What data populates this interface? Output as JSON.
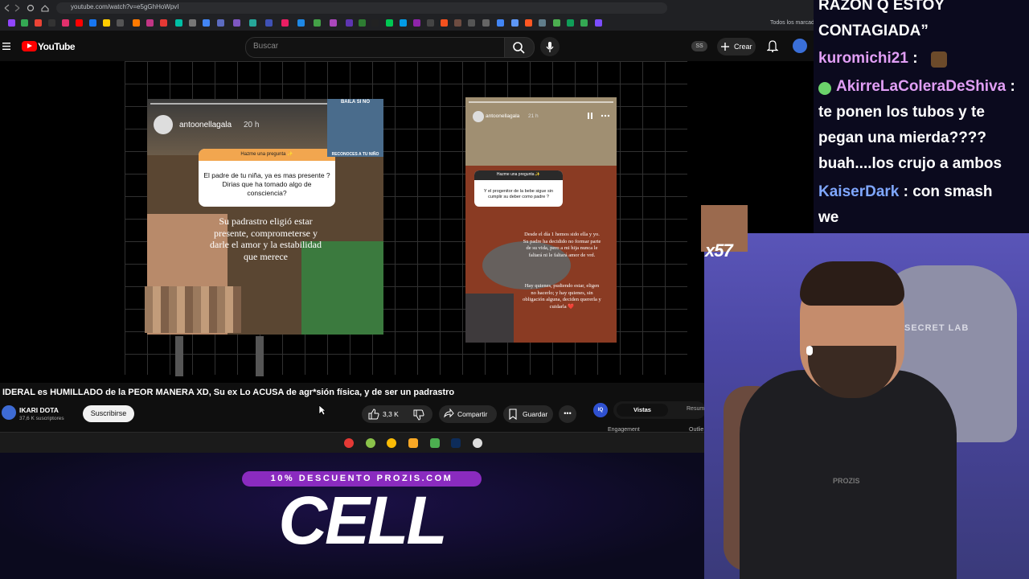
{
  "browser": {
    "url": "youtube.com/watch?v=e5gGhHoWpvI",
    "bookmarks_all": "Todos los marcador"
  },
  "youtube": {
    "logo_text": "YouTube",
    "search_placeholder": "Buscar",
    "lang_badge": "SS",
    "create_label": "Crear"
  },
  "video": {
    "story1": {
      "user": "antoonellagala",
      "time": "20 h",
      "question_title": "Hazme una pregunta ✨",
      "question": "El padre de tu niña, ya es mas presente ? Dirias que ha tomado algo de consciencia?",
      "answer": "Su padrastro eligió estar presente, comprometerse y darle el amor y la estabilidad que merece",
      "sticker_top": "BAILA SI NO",
      "sticker_bottom": "RECONOCES A TU NIÑO"
    },
    "story2": {
      "user": "antoonellagala",
      "time": "21 h",
      "question_title": "Hazme una pregunta ✨",
      "question": "Y el progenitor de la bebe sigue sin cumplir su deber como padre ?",
      "answer1": "Desde el día 1 hemos sido ella y yo. Su padre ha decidido no formar parte de su vida, pero a mi hija nunca le faltará ni le faltará amor de vrd.",
      "answer2": "Hay quienes, pudiendo estar, eligen no hacerlo; y hay quienes, sin obligación alguna, deciden quererla y cuidarla ❤️"
    }
  },
  "watch": {
    "title": "IDERAL es HUMILLADO de la PEOR MANERA XD, Su ex Lo ACUSA de agr*sión física, y de ser un padrastro",
    "channel_name": "IKARI DOTA",
    "subscribers": "37,6 K suscriptores",
    "subscribe_label": "Suscribirse",
    "likes": "3,3 K",
    "share_label": "Compartir",
    "save_label": "Guardar",
    "more_label": "•••",
    "ext_badge": "IQ",
    "tab_vistas": "Vistas",
    "tab_resumen": "Resum",
    "engagement_label": "Engagement",
    "outlier_label": "Outlie"
  },
  "promo": {
    "discount": "10% DESCUENTO PROZIS.COM",
    "big_text": "CELL"
  },
  "chat": {
    "lines": [
      {
        "text": "RAZON Q ESTOY"
      },
      {
        "text": "CONTAGIADA”"
      },
      {
        "name": "kuromichi21",
        "sep": " :"
      },
      {
        "name": "AkirreLaColeraDeShiva",
        "sep": " :"
      },
      {
        "text": "te ponen los tubos y te"
      },
      {
        "text": "pegan una mierda????"
      },
      {
        "text": "buah....los crujo a ambos"
      },
      {
        "name": "KaiserDark",
        "msg": " : con smash"
      },
      {
        "text": "we"
      }
    ]
  },
  "overlay": {
    "emote_count": "x57"
  },
  "webcam": {
    "chair_logo": "SECRET LAB",
    "shirt_logo": "PROZIS"
  },
  "colors": {
    "youtube_red": "#ff0000",
    "chat_name_pink": "#e19ef5",
    "chat_name_blue": "#7fa7ff",
    "promo_purple": "#8a2bbf"
  }
}
